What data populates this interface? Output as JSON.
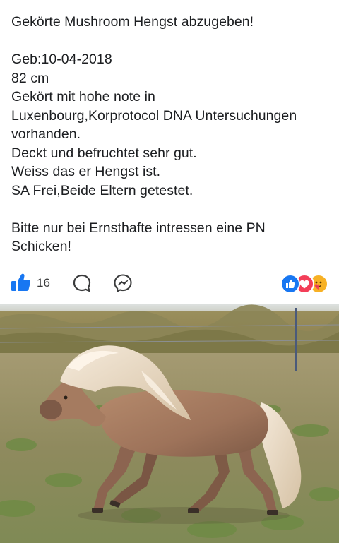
{
  "post": {
    "lines": [
      "Gekörte Mushroom Hengst abzugeben!",
      "",
      "Geb:10-04-2018",
      "82 cm",
      "Gekört mit hohe note in",
      "Luxenbourg,Korprotocol DNA Untersuchungen",
      "vorhanden.",
      "Deckt und befruchtet sehr gut.",
      "Weiss das er Hengst ist.",
      "SA Frei,Beide Eltern getestet.",
      "",
      "Bitte nur bei Ernsthafte intressen eine PN",
      "Schicken!"
    ]
  },
  "actions": {
    "like_count": "16",
    "like_icon": "thumbs-up-icon",
    "comment_icon": "comment-bubble-icon",
    "messenger_icon": "messenger-icon"
  },
  "reactions": {
    "icons": [
      "like-reaction-icon",
      "love-reaction-icon",
      "care-reaction-icon"
    ]
  },
  "colors": {
    "accent": "#1877f2",
    "love": "#f33e58",
    "care": "#f7b125",
    "text": "#1c1e21"
  },
  "photo": {
    "subject": "image-photo"
  }
}
